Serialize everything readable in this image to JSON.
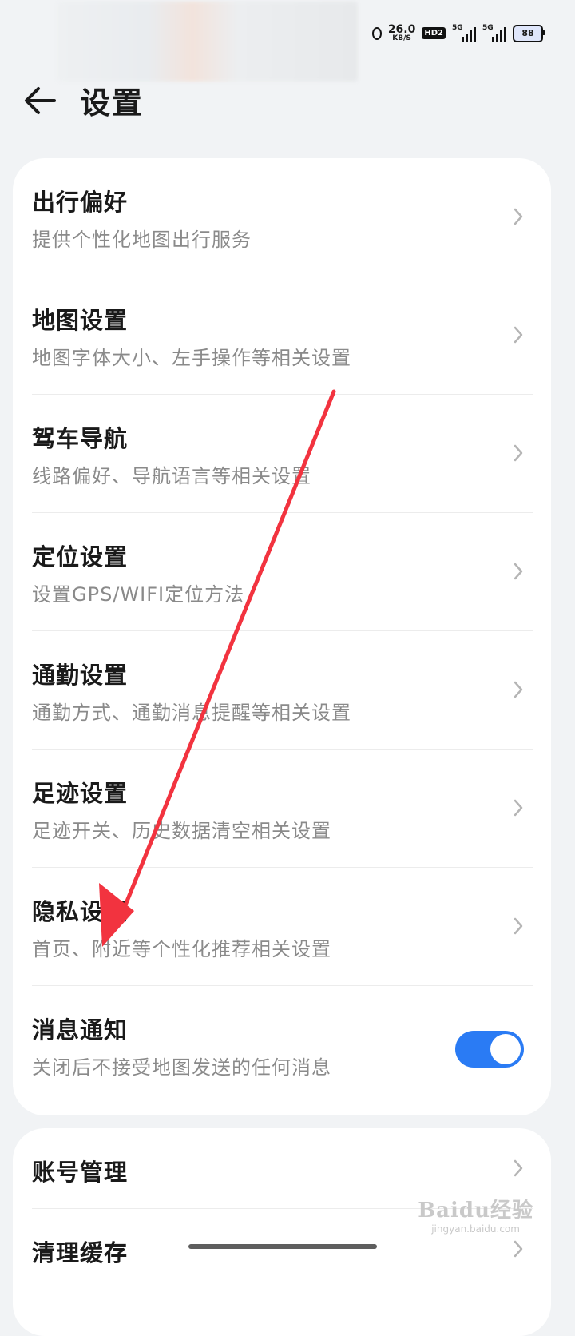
{
  "status_bar": {
    "speed_value": "26.0",
    "speed_unit": "KB/S",
    "hd_label": "HD2",
    "signal1_label": "5G",
    "signal2_label": "5G",
    "battery_level": "88"
  },
  "header": {
    "title": "设置"
  },
  "settings_card": {
    "items": [
      {
        "title": "出行偏好",
        "subtitle": "提供个性化地图出行服务"
      },
      {
        "title": "地图设置",
        "subtitle": "地图字体大小、左手操作等相关设置"
      },
      {
        "title": "驾车导航",
        "subtitle": "线路偏好、导航语言等相关设置"
      },
      {
        "title": "定位设置",
        "subtitle": "设置GPS/WIFI定位方法"
      },
      {
        "title": "通勤设置",
        "subtitle": "通勤方式、通勤消息提醒等相关设置"
      },
      {
        "title": "足迹设置",
        "subtitle": "足迹开关、历史数据清空相关设置"
      },
      {
        "title": "隐私设置",
        "subtitle": "首页、附近等个性化推荐相关设置"
      }
    ],
    "notification": {
      "title": "消息通知",
      "subtitle": "关闭后不接受地图发送的任何消息",
      "enabled": true
    }
  },
  "account_card": {
    "items": [
      {
        "title": "账号管理"
      },
      {
        "title": "清理缓存"
      }
    ]
  },
  "watermark": {
    "logo": "Baidu经验",
    "url": "jingyan.baidu.com"
  },
  "colors": {
    "toggle_on": "#2a7bf4",
    "annotation_arrow": "#f2333f",
    "background": "#f1f3f5"
  }
}
